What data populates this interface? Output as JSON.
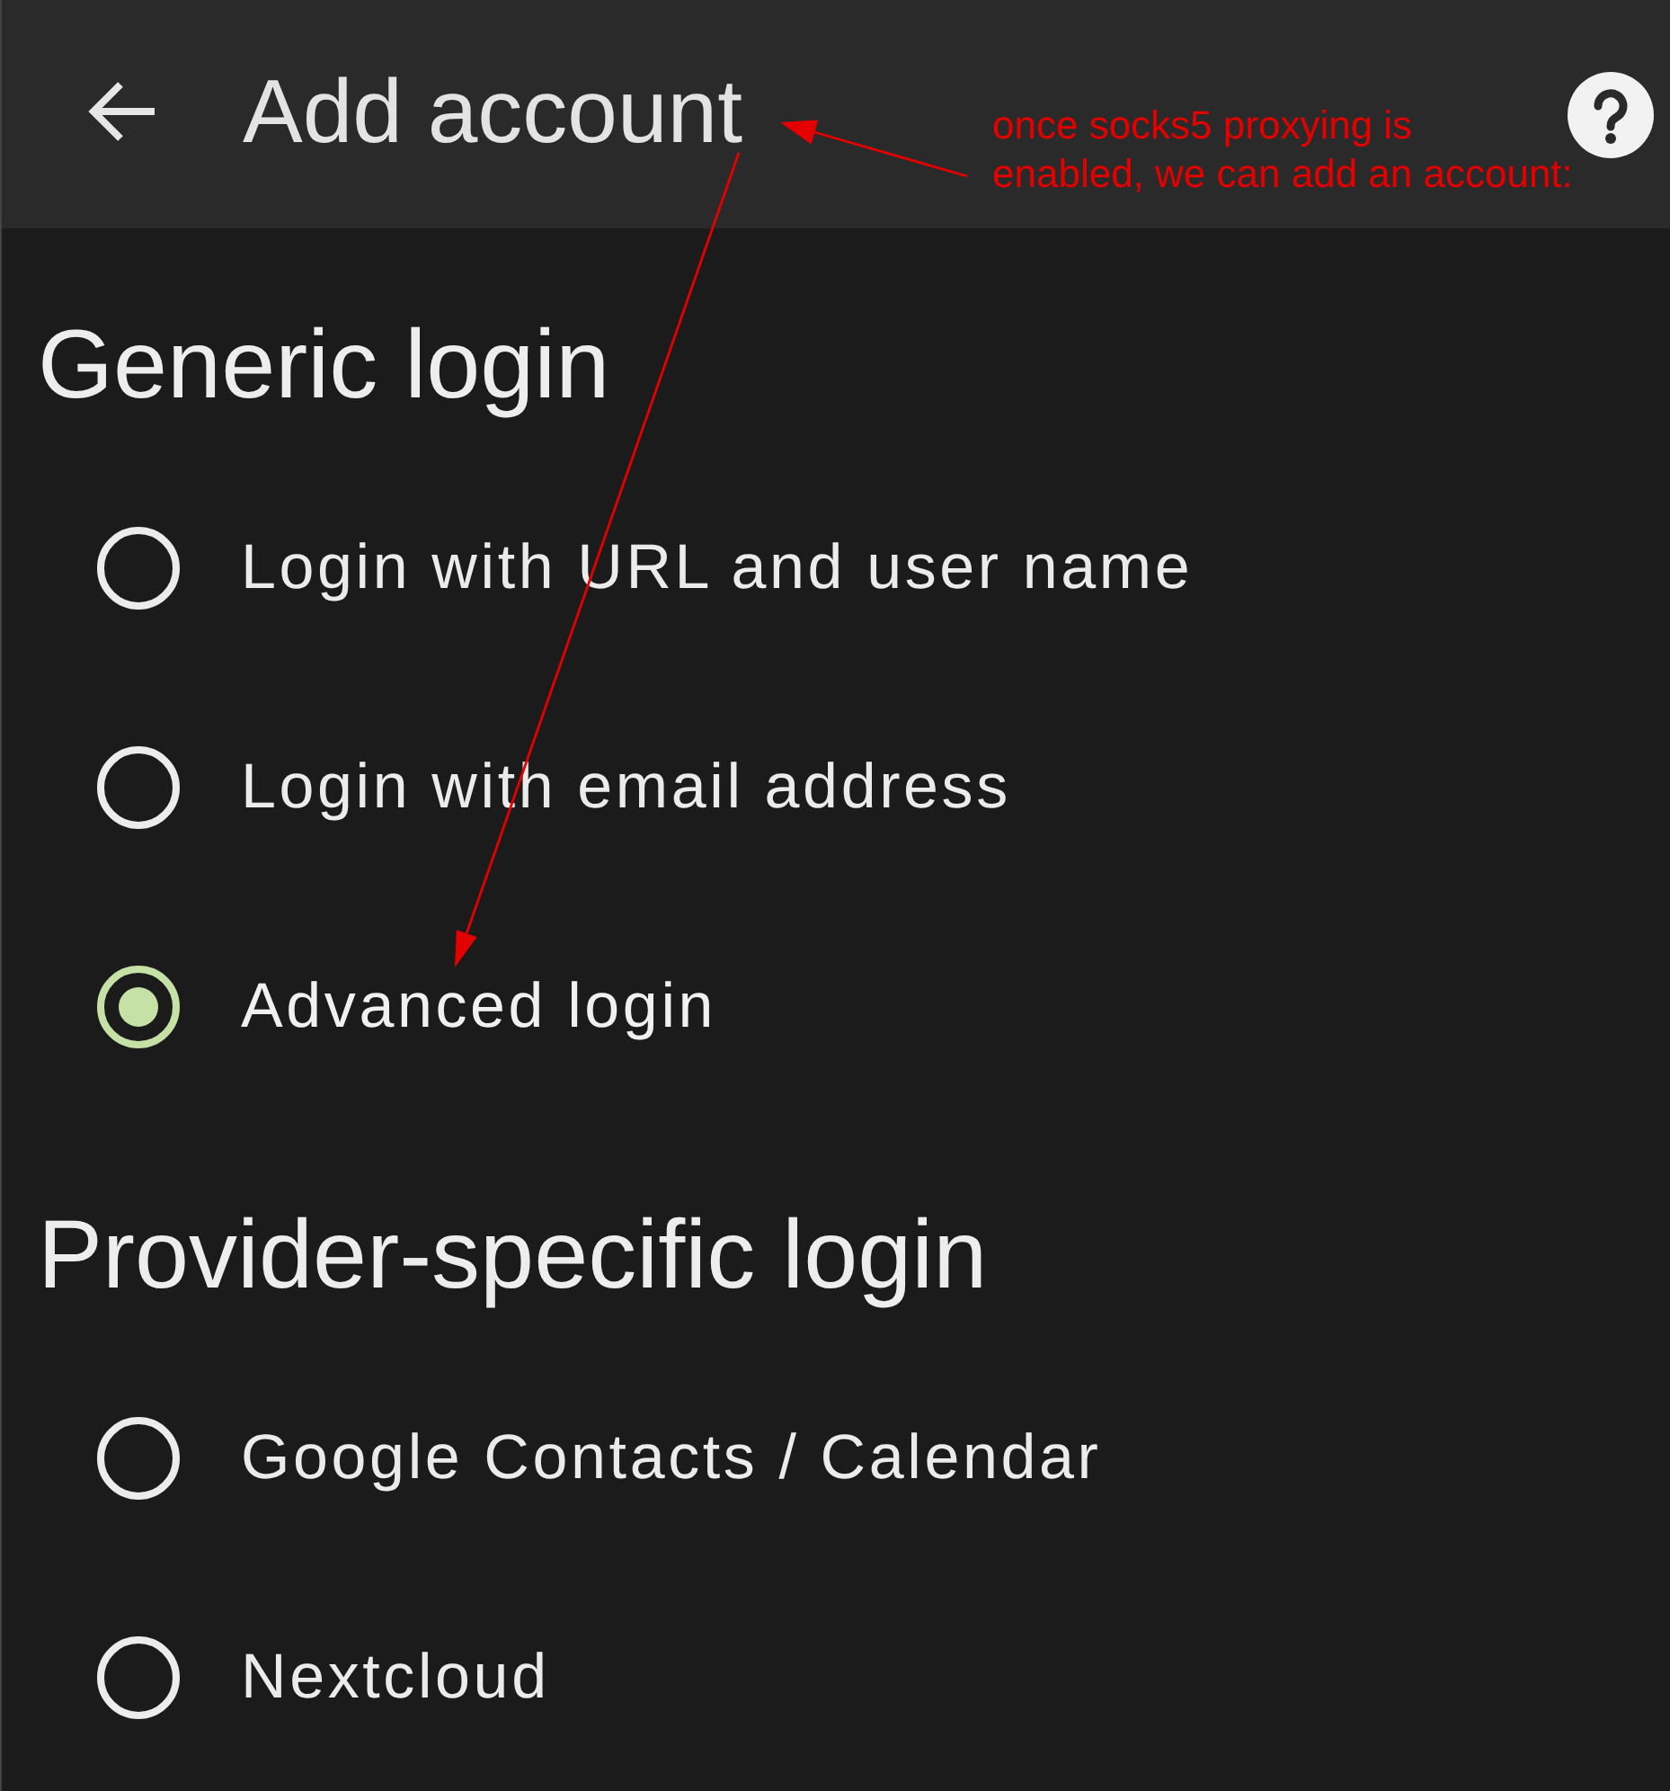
{
  "app_bar": {
    "title": "Add account"
  },
  "annotation": {
    "text": "once socks5 proxying is\nenabled, we can add an account:"
  },
  "sections": [
    {
      "heading": "Generic login",
      "options": [
        {
          "label": "Login with URL and user name",
          "selected": false
        },
        {
          "label": "Login with email address",
          "selected": false
        },
        {
          "label": "Advanced login",
          "selected": true
        }
      ]
    },
    {
      "heading": "Provider-specific login",
      "options": [
        {
          "label": "Google Contacts / Calendar",
          "selected": false
        },
        {
          "label": "Nextcloud",
          "selected": false
        }
      ]
    }
  ]
}
